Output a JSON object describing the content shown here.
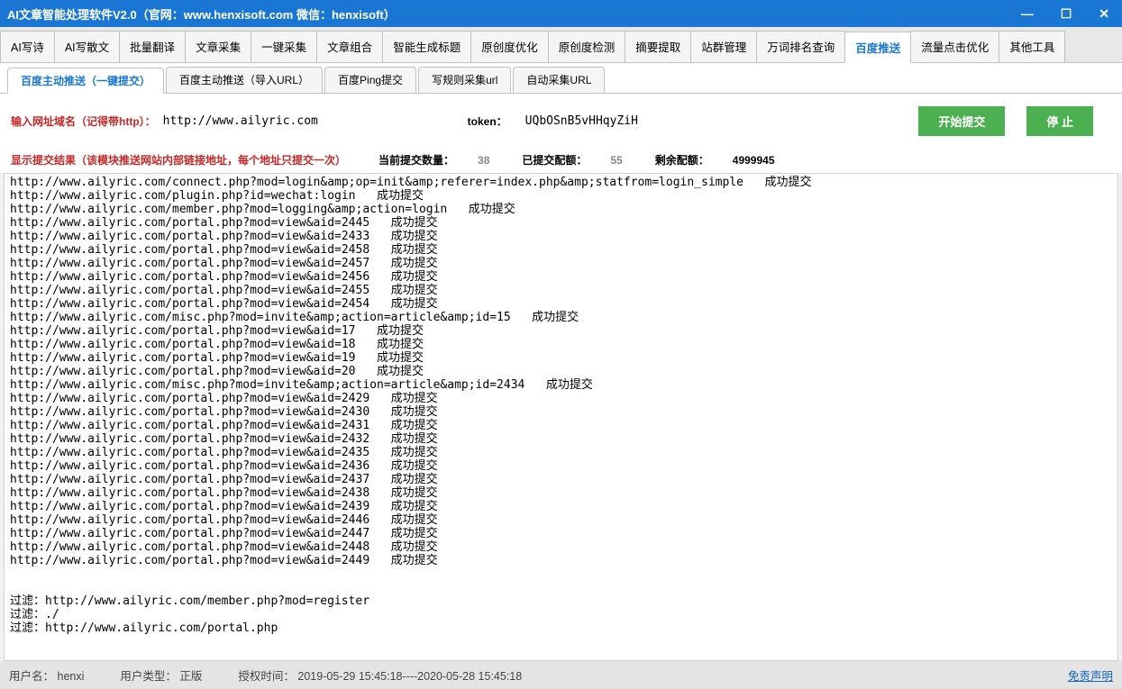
{
  "window": {
    "title": "AI文章智能处理软件V2.0（官网：www.henxisoft.com  微信：henxisoft）"
  },
  "mainTabs": [
    {
      "label": "AI写诗"
    },
    {
      "label": "AI写散文"
    },
    {
      "label": "批量翻译"
    },
    {
      "label": "文章采集"
    },
    {
      "label": "一键采集"
    },
    {
      "label": "文章组合"
    },
    {
      "label": "智能生成标题"
    },
    {
      "label": "原创度优化"
    },
    {
      "label": "原创度检测"
    },
    {
      "label": "摘要提取"
    },
    {
      "label": "站群管理"
    },
    {
      "label": "万词排名查询"
    },
    {
      "label": "百度推送",
      "active": true
    },
    {
      "label": "流量点击优化"
    },
    {
      "label": "其他工具"
    }
  ],
  "subTabs": [
    {
      "label": "百度主动推送（一键提交）",
      "active": true
    },
    {
      "label": "百度主动推送（导入URL）"
    },
    {
      "label": "百度Ping提交"
    },
    {
      "label": "写规则采集url"
    },
    {
      "label": "自动采集URL"
    }
  ],
  "input": {
    "domainLabel": "输入网址域名（记得带http）：",
    "domainValue": "http://www.ailyric.com",
    "tokenLabel": "token：",
    "tokenValue": "UQbOSnB5vHHqyZiH",
    "startBtn": "开始提交",
    "stopBtn": "停  止"
  },
  "status": {
    "resultLabel": "显示提交结果（该模块推送网站内部链接地址，每个地址只提交一次）",
    "currentLabel": "当前提交数量：",
    "currentValue": "38",
    "submittedLabel": "已提交配额：",
    "submittedValue": "55",
    "remainLabel": "剩余配额：",
    "remainValue": "4999945"
  },
  "log": "http://www.ailyric.com/connect.php?mod=login&amp;op=init&amp;referer=index.php&amp;statfrom=login_simple   成功提交\nhttp://www.ailyric.com/plugin.php?id=wechat:login   成功提交\nhttp://www.ailyric.com/member.php?mod=logging&amp;action=login   成功提交\nhttp://www.ailyric.com/portal.php?mod=view&aid=2445   成功提交\nhttp://www.ailyric.com/portal.php?mod=view&aid=2433   成功提交\nhttp://www.ailyric.com/portal.php?mod=view&aid=2458   成功提交\nhttp://www.ailyric.com/portal.php?mod=view&aid=2457   成功提交\nhttp://www.ailyric.com/portal.php?mod=view&aid=2456   成功提交\nhttp://www.ailyric.com/portal.php?mod=view&aid=2455   成功提交\nhttp://www.ailyric.com/portal.php?mod=view&aid=2454   成功提交\nhttp://www.ailyric.com/misc.php?mod=invite&amp;action=article&amp;id=15   成功提交\nhttp://www.ailyric.com/portal.php?mod=view&aid=17   成功提交\nhttp://www.ailyric.com/portal.php?mod=view&aid=18   成功提交\nhttp://www.ailyric.com/portal.php?mod=view&aid=19   成功提交\nhttp://www.ailyric.com/portal.php?mod=view&aid=20   成功提交\nhttp://www.ailyric.com/misc.php?mod=invite&amp;action=article&amp;id=2434   成功提交\nhttp://www.ailyric.com/portal.php?mod=view&aid=2429   成功提交\nhttp://www.ailyric.com/portal.php?mod=view&aid=2430   成功提交\nhttp://www.ailyric.com/portal.php?mod=view&aid=2431   成功提交\nhttp://www.ailyric.com/portal.php?mod=view&aid=2432   成功提交\nhttp://www.ailyric.com/portal.php?mod=view&aid=2435   成功提交\nhttp://www.ailyric.com/portal.php?mod=view&aid=2436   成功提交\nhttp://www.ailyric.com/portal.php?mod=view&aid=2437   成功提交\nhttp://www.ailyric.com/portal.php?mod=view&aid=2438   成功提交\nhttp://www.ailyric.com/portal.php?mod=view&aid=2439   成功提交\nhttp://www.ailyric.com/portal.php?mod=view&aid=2446   成功提交\nhttp://www.ailyric.com/portal.php?mod=view&aid=2447   成功提交\nhttp://www.ailyric.com/portal.php?mod=view&aid=2448   成功提交\nhttp://www.ailyric.com/portal.php?mod=view&aid=2449   成功提交\n\n\n过滤：http://www.ailyric.com/member.php?mod=register\n过滤：./\n过滤：http://www.ailyric.com/portal.php",
  "footer": {
    "userLabel": "用户名：",
    "userValue": "henxi",
    "typeLabel": "用户类型：",
    "typeValue": "正版",
    "authLabel": "授权时间：",
    "authValue": "2019-05-29 15:45:18----2020-05-28 15:45:18",
    "disclaimer": "免责声明"
  }
}
